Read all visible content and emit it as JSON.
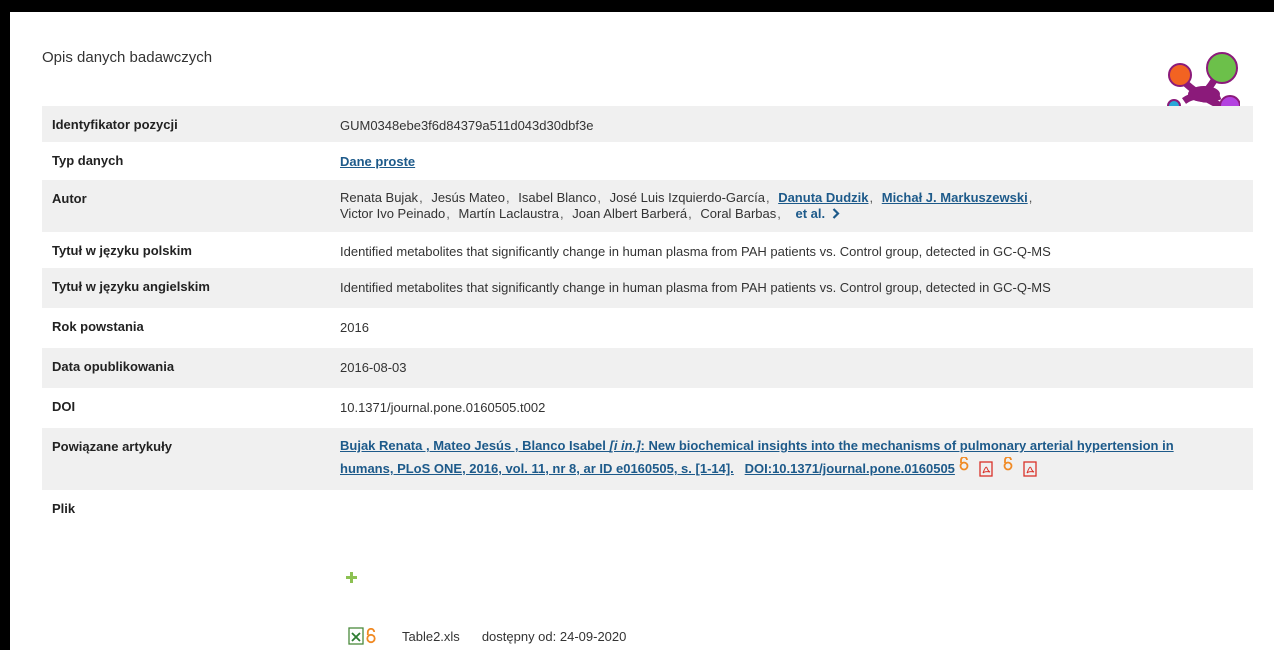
{
  "section_title": "Opis danych badawczych",
  "rows": {
    "id": {
      "label": "Identyfikator pozycji",
      "value": "GUM0348ebe3f6d84379a511d043d30dbf3e"
    },
    "type": {
      "label": "Typ danych",
      "value": "Dane proste"
    },
    "author": {
      "label": "Autor",
      "line1": [
        "Renata Bujak",
        "Jesús Mateo",
        "Isabel Blanco",
        "José Luis Izquierdo-García",
        "Danuta Dudzik",
        "Michał J. Markuszewski"
      ],
      "line2": [
        "Victor Ivo Peinado",
        "Martín Laclaustra",
        "Joan Albert Barberá",
        "Coral Barbas"
      ],
      "et_al": "et al."
    },
    "title_pl": {
      "label": "Tytuł w języku polskim",
      "value": "Identified metabolites that significantly change in human plasma from PAH patients vs. Control group, detected in GC-Q-MS"
    },
    "title_en": {
      "label": "Tytuł w języku angielskim",
      "value": "Identified metabolites that significantly change in human plasma from PAH patients vs. Control group, detected in GC-Q-MS"
    },
    "year": {
      "label": "Rok powstania",
      "value": "2016"
    },
    "published": {
      "label": "Data opublikowania",
      "value": "2016-08-03"
    },
    "doi": {
      "label": "DOI",
      "value": "10.1371/journal.pone.0160505.t002"
    },
    "related": {
      "label": "Powiązane artykuły",
      "authors": "Bujak Renata , Mateo Jesús , Blanco Isabel ",
      "in": "[i in.]",
      "text1": ": New biochemical insights into the mechanisms of pulmonary arterial hypertension in",
      "text2": "humans, PLoS ONE, 2016, vol. 11, nr 8, ar ID e0160505, s. [1-14].",
      "doi": "DOI:10.1371/journal.pone.0160505"
    },
    "file": {
      "label": "Plik",
      "name": "Table2.xls",
      "available": "dostępny od: 24-09-2020"
    }
  },
  "colors": {
    "link": "#1d5a8a",
    "shade": "#f0f0f0",
    "oa_orange": "#f08a24",
    "pdf_red": "#d9322a"
  }
}
